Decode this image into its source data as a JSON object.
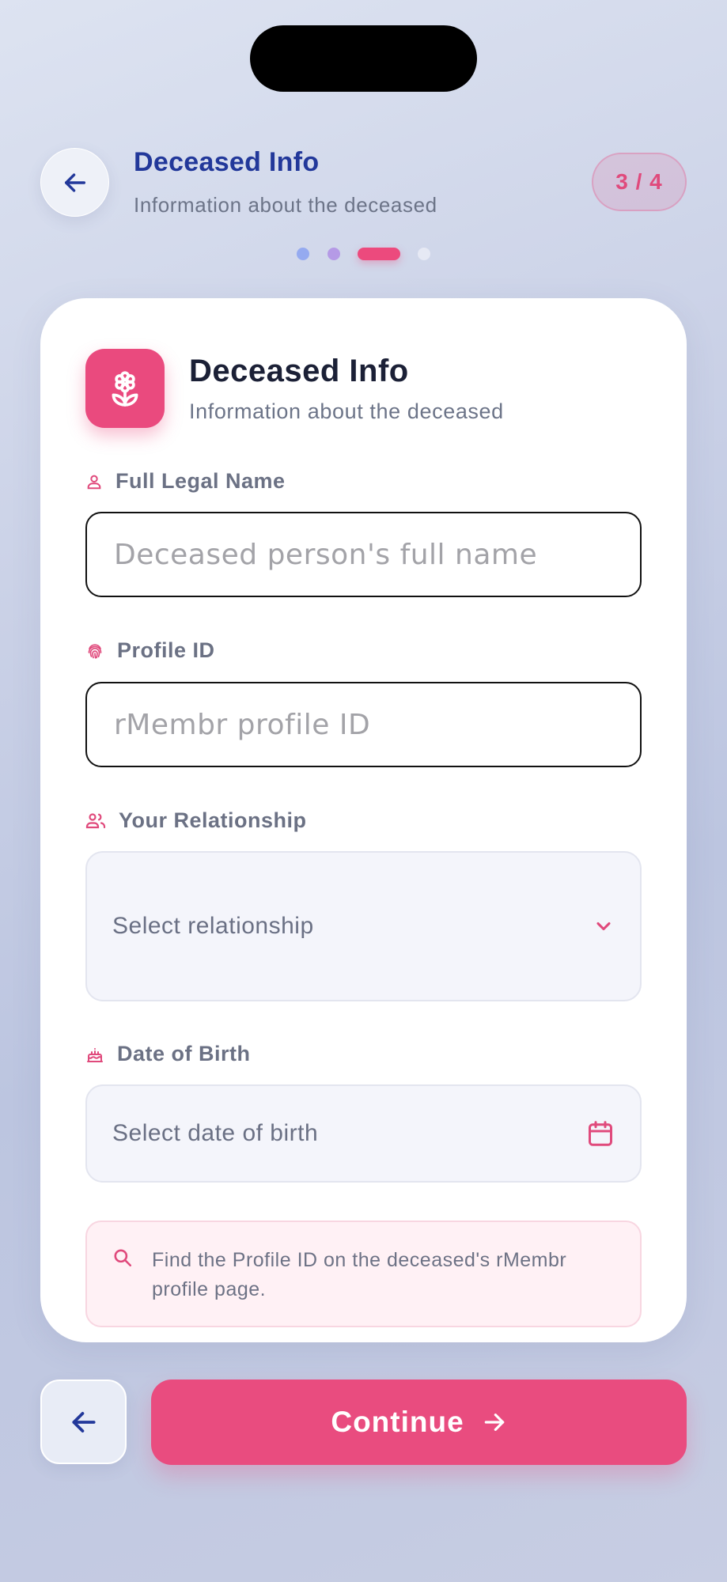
{
  "header": {
    "title": "Deceased Info",
    "subtitle": "Information about the deceased",
    "step": "3 / 4"
  },
  "progress": {
    "total_steps": 4,
    "current_step": 3
  },
  "card": {
    "title": "Deceased Info",
    "subtitle": "Information about the deceased",
    "icon": "flower-icon"
  },
  "form": {
    "full_name": {
      "label": "Full Legal Name",
      "placeholder": "Deceased person's full name",
      "value": "",
      "icon": "person-icon"
    },
    "profile_id": {
      "label": "Profile ID",
      "placeholder": "rMembr profile ID",
      "value": "",
      "icon": "fingerprint-icon"
    },
    "relationship": {
      "label": "Your Relationship",
      "placeholder": "Select relationship",
      "icon": "people-icon"
    },
    "dob": {
      "label": "Date of Birth",
      "placeholder": "Select date of birth",
      "icon": "cake-icon"
    }
  },
  "hint": {
    "text": "Find the Profile ID on the deceased's rMembr profile page.",
    "icon": "search-icon"
  },
  "footer": {
    "continue_label": "Continue"
  },
  "colors": {
    "accent": "#e94c7f",
    "title_blue": "#22389a",
    "card_bg": "#ffffff"
  }
}
